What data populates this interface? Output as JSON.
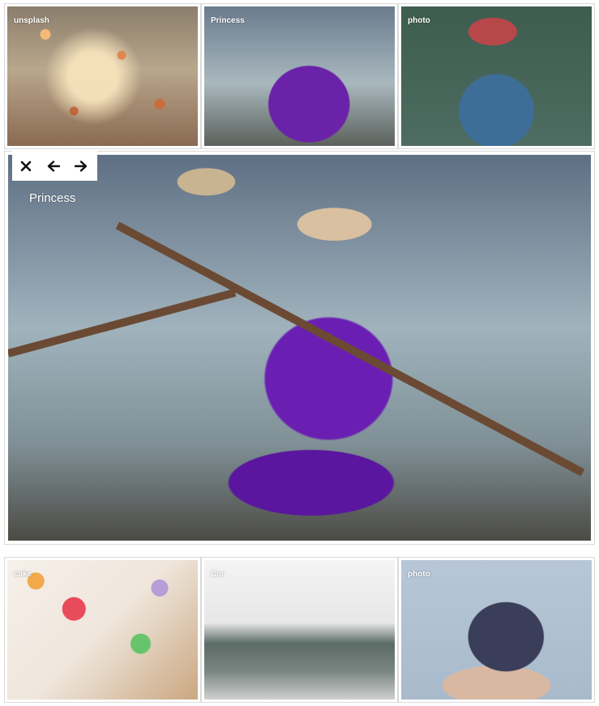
{
  "gallery": {
    "top_row": [
      {
        "label": "unsplash",
        "scene": "autumn-leaves"
      },
      {
        "label": "Princess",
        "scene": "boat-woman-purple-dress"
      },
      {
        "label": "photo",
        "scene": "woman-with-camera"
      }
    ],
    "bottom_row": [
      {
        "label": "cake",
        "scene": "decorated-cake"
      },
      {
        "label": "Car",
        "scene": "vintage-car"
      },
      {
        "label": "photo",
        "scene": "hands-with-grapes"
      }
    ]
  },
  "viewer": {
    "caption": "Princess",
    "controls": {
      "close_icon": "close-icon",
      "prev_icon": "arrow-left-icon",
      "next_icon": "arrow-right-icon"
    }
  }
}
